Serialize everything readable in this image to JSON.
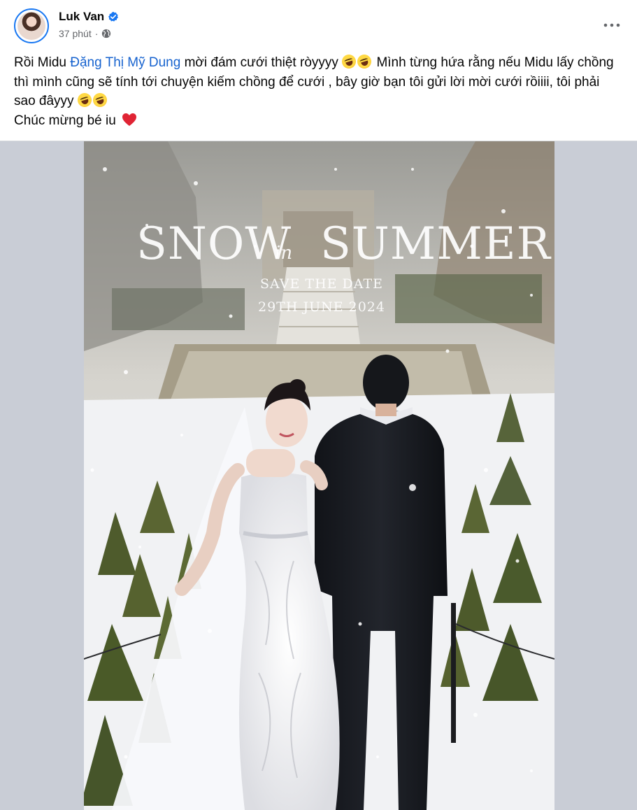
{
  "post": {
    "author_name": "Luk Van",
    "timestamp": "37 phút",
    "privacy_icon": "globe-icon",
    "verified_icon": "verified-badge-icon",
    "more_icon": "more-options-icon",
    "text_line1_before_mention": "Rồi Midu ",
    "mention": "Đặng Thị Mỹ Dung",
    "text_line1_after_mention": " mời đám cưới thiệt ròyyyy ",
    "text_continued": " Mình từng hứa rằng nếu Midu lấy chồng thì mình cũng sẽ tính tới chuyện kiếm chồng để cưới , bây giờ bạn tôi gửi lời mời cưới rồiiii, tôi phải sao đâyyy ",
    "closing_line": "Chúc mừng bé iu ",
    "emoji_laugh": "rolling-on-floor-laughing-emoji",
    "emoji_heart": "red-heart-emoji"
  },
  "image": {
    "title_word1": "SNOW",
    "title_connector": "in",
    "title_word2": "SUMMER",
    "save_the_date": "SAVE THE DATE",
    "date": "29TH JUNE 2024"
  },
  "colors": {
    "accent_blue": "#1877f2",
    "mention_blue": "#1763cf",
    "secondary_text": "#65676b",
    "media_background": "#c9cdd6"
  }
}
